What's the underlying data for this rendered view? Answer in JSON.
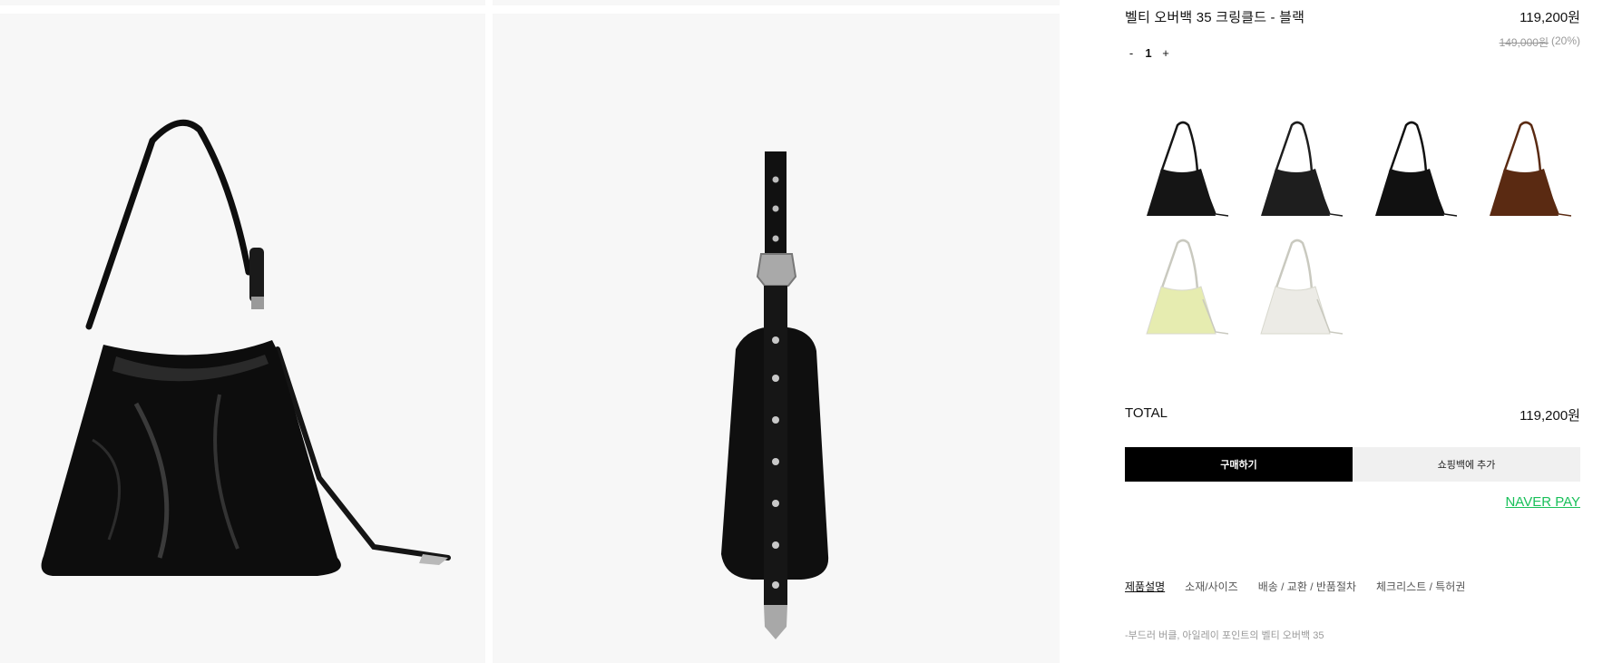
{
  "product": {
    "name": "벨티 오버백 35 크링클드 - 블랙",
    "price": "119,200원",
    "original_price": "149,000원",
    "discount": "(20%)",
    "quantity": "1",
    "qty_minus": "-",
    "qty_plus": "+"
  },
  "swatches": [
    {
      "color_name": "black-crinkled",
      "color": "#151515"
    },
    {
      "color_name": "black-smooth",
      "color": "#1e1e1e"
    },
    {
      "color_name": "black-glossy",
      "color": "#111111"
    },
    {
      "color_name": "brown",
      "color": "#5a2a12"
    },
    {
      "color_name": "lime",
      "color": "#e6ecb0"
    },
    {
      "color_name": "ivory",
      "color": "#ecebe6"
    }
  ],
  "total": {
    "label": "TOTAL",
    "value": "119,200원"
  },
  "actions": {
    "buy_label": "구매하기",
    "cart_label": "쇼핑백에 추가",
    "naver_pay_label": "NAVER PAY"
  },
  "colors": {
    "naver_green": "#19c05a",
    "buy_bg": "#000000",
    "cart_bg": "#f0f0f0",
    "photo_bg": "#f7f7f7"
  },
  "tabs": [
    {
      "label": "제품설명",
      "active": true
    },
    {
      "label": "소재/사이즈",
      "active": false
    },
    {
      "label": "배송 / 교환 / 반품절차",
      "active": false
    },
    {
      "label": "체크리스트 / 특허권",
      "active": false
    }
  ],
  "description_preview": "-부드러 버클, 아일레이 포인트의 벨티 오버백 35"
}
